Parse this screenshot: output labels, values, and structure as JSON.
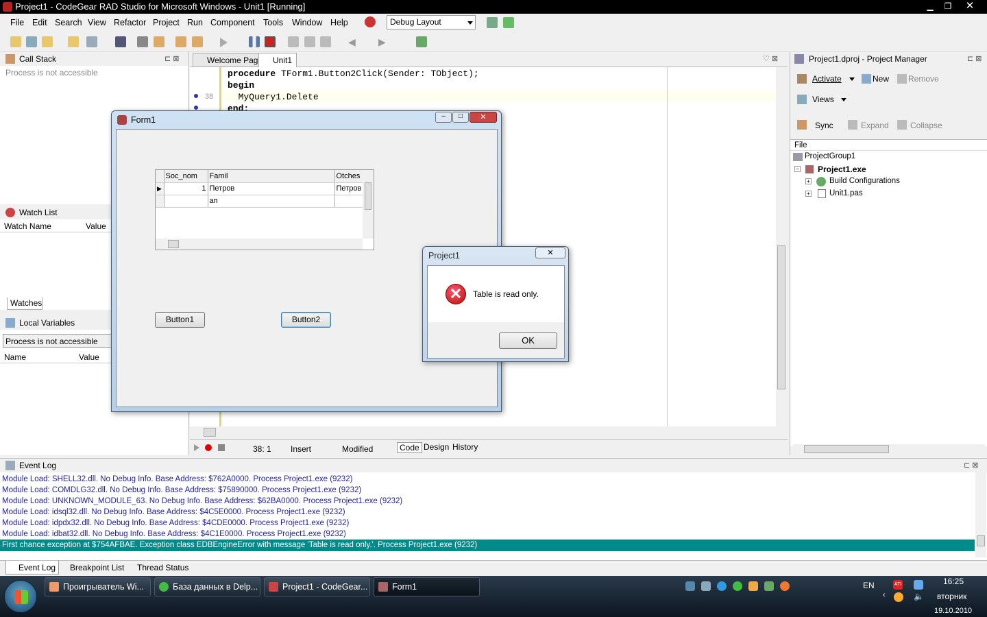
{
  "window": {
    "title": "Project1 - CodeGear RAD Studio for Microsoft Windows - Unit1 [Running]"
  },
  "menu": [
    "File",
    "Edit",
    "Search",
    "View",
    "Refactor",
    "Project",
    "Run",
    "Component",
    "Tools",
    "Window",
    "Help"
  ],
  "layout_combo": {
    "value": "Debug Layout"
  },
  "left": {
    "call_stack": {
      "title": "Call Stack",
      "status": "Process is not accessible"
    },
    "watch_list": {
      "title": "Watch List",
      "col_name": "Watch Name",
      "col_value": "Value",
      "tab": "Watches"
    },
    "local_vars": {
      "title": "Local Variables",
      "status": "Process is not accessible",
      "col_name": "Name",
      "col_value": "Value"
    }
  },
  "editor": {
    "tabs": [
      "Welcome Page",
      "Unit1"
    ],
    "lines": [
      {
        "num": "",
        "kw": "procedure",
        "text": " TForm1.Button2Click(Sender: TObject);"
      },
      {
        "num": "",
        "kw": "begin",
        "text": ""
      },
      {
        "num": "38",
        "kw": "",
        "text": "  MyQuery1.Delete"
      },
      {
        "num": "",
        "kw": "end;",
        "text": ""
      }
    ],
    "status": {
      "pos": "38:  1",
      "mode": "Insert",
      "modified": "Modified"
    },
    "bottom_tabs": [
      "Code",
      "Design",
      "History"
    ]
  },
  "form1": {
    "title": "Form1",
    "grid": {
      "headers": [
        "Soc_nom",
        "Famil",
        "Otches"
      ],
      "rows": [
        [
          "1",
          "Петров",
          "Петров"
        ],
        [
          "",
          "ап",
          ""
        ]
      ]
    },
    "button1": "Button1",
    "button2": "Button2"
  },
  "dialog": {
    "title": "Project1",
    "message": "Table is read only.",
    "ok": "OK",
    "close": "✕"
  },
  "project_manager": {
    "title": "Project1.dproj - Project Manager",
    "activate": "Activate",
    "new": "New",
    "remove": "Remove",
    "views": "Views",
    "sync": "Sync",
    "expand": "Expand",
    "collapse": "Collapse",
    "col_file": "File",
    "tree": {
      "group": "ProjectGroup1",
      "project": "Project1.exe",
      "build": "Build Configurations",
      "unit": "Unit1.pas"
    }
  },
  "event_log": {
    "title": "Event Log",
    "lines": [
      "Module Load: SHELL32.dll. No Debug Info. Base Address: $762A0000. Process Project1.exe (9232)",
      "Module Load: COMDLG32.dll. No Debug Info. Base Address: $75890000. Process Project1.exe (9232)",
      "Module Load: UNKNOWN_MODULE_63. No Debug Info. Base Address: $62BA0000. Process Project1.exe (9232)",
      "Module Load: idsql32.dll. No Debug Info. Base Address: $4C5E0000. Process Project1.exe (9232)",
      "Module Load: idpdx32.dll. No Debug Info. Base Address: $4CDE0000. Process Project1.exe (9232)",
      "Module Load: idbat32.dll. No Debug Info. Base Address: $4C1E0000. Process Project1.exe (9232)"
    ],
    "highlight": "First chance exception at $754AFBAE. Exception class EDBEngineError with message 'Table is read only.'. Process Project1.exe (9232)",
    "tabs": [
      "Event Log",
      "Breakpoint List",
      "Thread Status"
    ]
  },
  "taskbar": {
    "items": [
      "Проигрыватель Wi...",
      "База данных в Delp...",
      "Project1 - CodeGear...",
      "Form1"
    ],
    "lang": "EN",
    "time": "16:25",
    "day": "вторник",
    "date": "19.10.2010"
  },
  "colors": {
    "highlight": "#008b8b",
    "event_text": "#1f1fa0"
  }
}
